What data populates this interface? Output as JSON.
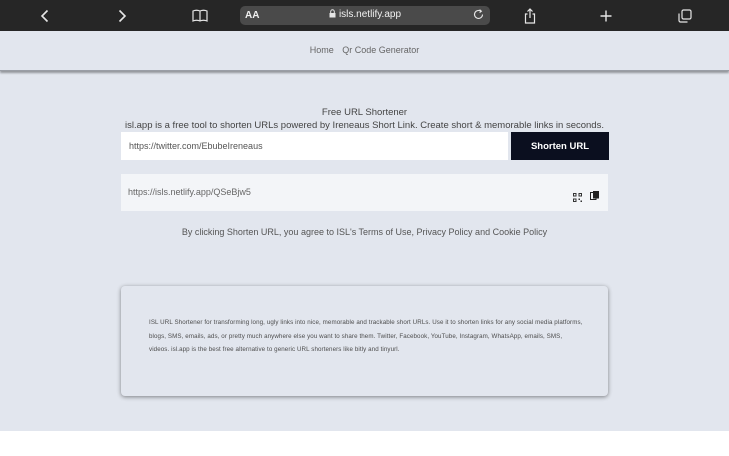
{
  "browser": {
    "text_size_label": "AA",
    "address": "isls.netlify.app",
    "icons": [
      "back-icon",
      "forward-icon",
      "bookmarks-icon",
      "lock-icon",
      "reload-icon",
      "share-icon",
      "new-tab-icon",
      "tabs-icon"
    ]
  },
  "nav": {
    "home": "Home",
    "qr": "Qr Code Generator"
  },
  "hero": {
    "title": "Free URL Shortener",
    "subtitle": "isl.app is a free tool to shorten URLs powered by Ireneaus Short Link. Create short & memorable links in seconds."
  },
  "form": {
    "url_value": "https://twitter.com/EbubeIreneaus",
    "button_label": "Shorten URL"
  },
  "result": {
    "short_url": "https://isls.netlify.app/QSeBjw5"
  },
  "terms": "By clicking Shorten URL, you agree to ISL's Terms of Use, Privacy Policy and Cookie Policy",
  "about": "ISL URL Shortener for transforming long, ugly links into nice, memorable and trackable short URLs. Use it to shorten links for any social media platforms, blogs, SMS, emails, ads, or pretty much anywhere else you want to share them. Twitter, Facebook, YouTube, Instagram, WhatsApp, emails, SMS, videos. isl.app is the best free alternative to generic URL shorteners like bitly and tinyurl.",
  "colors": {
    "toolbar": "#262626",
    "page_bg": "#e2e6ee",
    "button_bg": "#0b0f1f"
  }
}
